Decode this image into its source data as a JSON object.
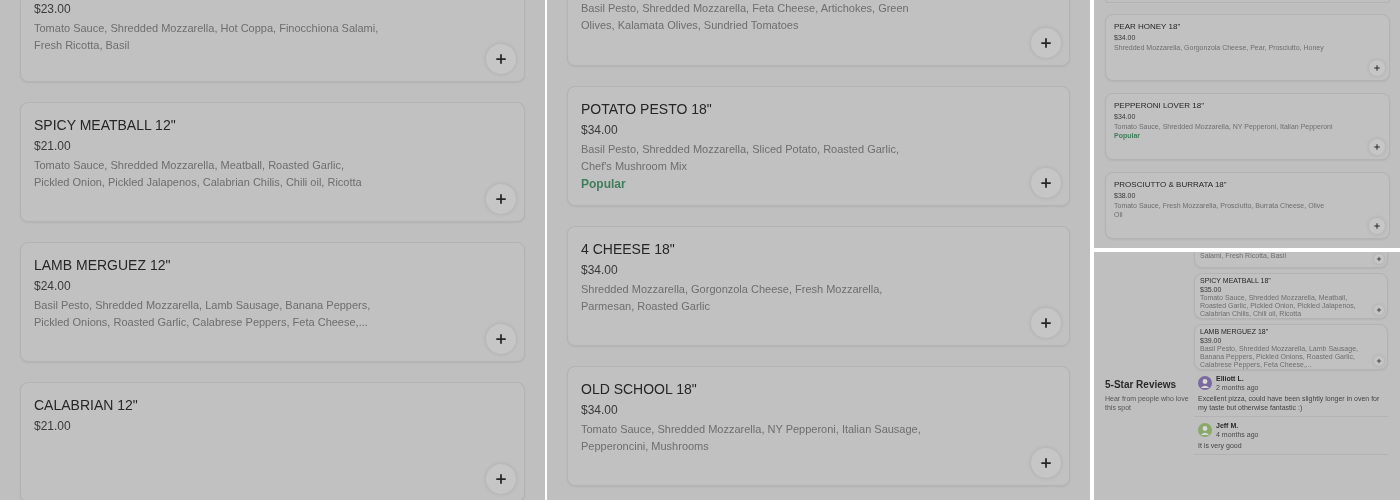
{
  "panels": [
    {
      "cards": [
        {
          "price": "$23.00",
          "description": "Tomato Sauce, Shredded Mozzarella, Hot Coppa, Finocchiona Salami, Fresh Ricotta, Basil"
        },
        {
          "name": "SPICY MEATBALL 12\"",
          "price": "$21.00",
          "description": "Tomato Sauce, Shredded Mozzarella, Meatball, Roasted Garlic, Pickled Onion, Pickled Jalapenos, Calabrian Chilis, Chili oil, Ricotta"
        },
        {
          "name": "LAMB MERGUEZ 12\"",
          "price": "$24.00",
          "description": "Basil Pesto, Shredded Mozzarella, Lamb Sausage, Banana Peppers, Pickled Onions, Roasted Garlic, Calabrese Peppers, Feta Cheese,..."
        },
        {
          "name": "CALABRIAN 12\"",
          "price": "$21.00"
        }
      ]
    },
    {
      "cards": [
        {
          "description": "Basil Pesto, Shredded Mozzarella, Feta Cheese, Artichokes, Green Olives, Kalamata Olives, Sundried Tomatoes"
        },
        {
          "name": "POTATO PESTO 18\"",
          "price": "$34.00",
          "description": "Basil Pesto, Shredded Mozzarella, Sliced Potato, Roasted Garlic, Chef's Mushroom Mix",
          "tag": "Popular"
        },
        {
          "name": "4 CHEESE 18\"",
          "price": "$34.00",
          "description": "Shredded Mozzarella, Gorgonzola Cheese, Fresh Mozzarella, Parmesan, Roasted Garlic"
        },
        {
          "name": "OLD SCHOOL 18\"",
          "price": "$34.00",
          "description": "Tomato Sauce, Shredded Mozzarella, NY Pepperoni, Italian Sausage, Pepperoncini, Mushrooms"
        }
      ]
    },
    {
      "cards": [
        {
          "name": "PEAR HONEY 18\"",
          "price": "$34.00",
          "description": "Shredded Mozzarella, Gorgonzola Cheese, Pear, Prosciutto, Honey"
        },
        {
          "name": "PEPPERONI LOVER 18\"",
          "price": "$34.00",
          "description": "Tomato Sauce, Shredded Mozzarella, NY Pepperoni, Italian Pepperoni",
          "tag": "Popular"
        },
        {
          "name": "PROSCIUTTO & BURRATA 18\"",
          "price": "$38.00",
          "description": "Tomato Sauce, Fresh Mozzarella, Prosciutto, Burrata Cheese, Olive Oil"
        }
      ]
    },
    {
      "cards": [
        {
          "description": "Salami, Fresh Ricotta, Basil"
        },
        {
          "name": "SPICY MEATBALL 18\"",
          "price": "$35.00",
          "description": "Tomato Sauce, Shredded Mozzarella, Meatball, Roasted Garlic, Pickled Onion, Pickled Jalapenos, Calabrian Chilis, Chili oil, Ricotta"
        },
        {
          "name": "LAMB MERGUEZ 18\"",
          "price": "$39.00",
          "description": "Basil Pesto, Shredded Mozzarella, Lamb Sausage, Banana Peppers, Pickled Onions, Roasted Garlic, Calabrese Peppers, Feta Cheese,..."
        }
      ],
      "reviews": {
        "title": "5-Star Reviews",
        "subtitle": "Hear from people who love this spot",
        "items": [
          {
            "author": "Elliott L.",
            "time": "2 months ago",
            "text": "Excellent pizza, could have been slightly longer in oven for my taste but otherwise fantastic :)",
            "color": "#7a6aa0"
          },
          {
            "author": "Jeff M.",
            "time": "4 months ago",
            "text": "It is very good",
            "color": "#8aa86a"
          }
        ]
      }
    }
  ]
}
